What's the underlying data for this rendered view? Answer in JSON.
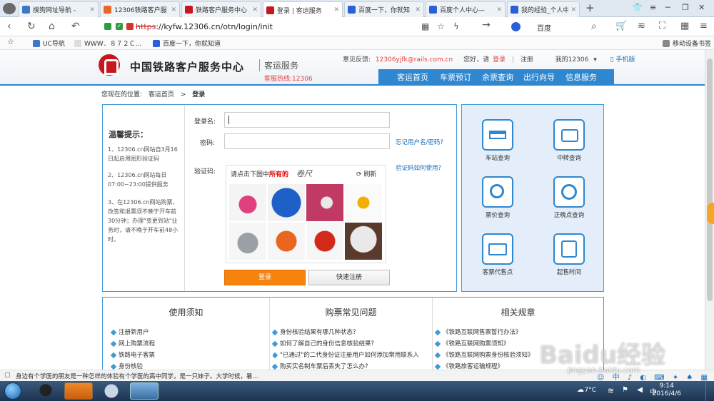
{
  "browser": {
    "tabs": [
      {
        "label": "搜狗网址导航 - ",
        "color": "#3c78c8"
      },
      {
        "label": "12306铁路客户服",
        "color": "#e8652b"
      },
      {
        "label": "铁路客户服务中心",
        "color": "#c8161d"
      },
      {
        "label": "登录 | 客运服务",
        "color": "#c8161d"
      },
      {
        "label": "百度一下，你就知",
        "color": "#2a5fd8"
      },
      {
        "label": "百度个人中心—",
        "color": "#2a5fd8"
      },
      {
        "label": "我的经验_个人中",
        "color": "#2a5fd8"
      }
    ],
    "new_tab": "+",
    "url_scheme": "https",
    "url_rest": "://kyfw.12306.cn/otn/login/init",
    "search_engine": "百度",
    "bookmarks": [
      "UC导航",
      "WWW．８７２Ｃ...",
      "百度一下，你就知道"
    ],
    "mobile_bookmarks": "移动设备书签"
  },
  "header": {
    "site_name": "中国铁路客户服务中心",
    "site_sub": "客运服务",
    "hotline": "客服热线:12306",
    "feedback_label": "意见反馈:",
    "feedback_email": "12306yjfk@rails.com.cn",
    "greeting": "您好，请",
    "login_link": "登录",
    "register_link": "注册",
    "my12306": "我的12306",
    "mobile": "手机版",
    "nav": [
      "客运首页",
      "车票预订",
      "余票查询",
      "出行向导",
      "信息服务"
    ]
  },
  "breadcrumb": {
    "prefix": "您现在的位置:",
    "home": "客运首页",
    "sep": ">",
    "current": "登录"
  },
  "tips": {
    "title": "温馨提示：",
    "items": [
      "1、12306.cn网站自3月16日起启用图形验证码",
      "2、12306.cn网站每日07:00~23:00提供服务",
      "3、在12306.cn网站购票、改签和退票须不晚于开车前30分钟；办理\"变更到站\"业务时，请不晚于开车前48小时。"
    ]
  },
  "login": {
    "username_label": "登录名:",
    "password_label": "密码:",
    "forgot_link": "忘记用户名/密码?",
    "captcha_label": "验证码:",
    "captcha_help": "验证码如何使用?",
    "captcha_prompt_a": "请点击下图中",
    "captcha_prompt_b": "所有的",
    "captcha_word": "卷尺",
    "refresh": "刷新",
    "login_button": "登录",
    "register_button": "快速注册"
  },
  "services": [
    {
      "label": "车站查询"
    },
    {
      "label": "中转查询"
    },
    {
      "label": "票价查询"
    },
    {
      "label": "正晚点查询"
    },
    {
      "label": "客票代售点"
    },
    {
      "label": "起售时间"
    }
  ],
  "info": {
    "columns": [
      {
        "title": "使用须知",
        "items": [
          "注册新用户",
          "网上购票流程",
          "铁路电子客票",
          "身份核验"
        ]
      },
      {
        "title": "购票常见问题",
        "items": [
          "身份核验结果有哪几种状态?",
          "如何了解自己的身份信息核验结果?",
          "\"已通过\"的二代身份证注册用户如何添加常用联系人",
          "购买实名制车票后丢失了怎么办?"
        ]
      },
      {
        "title": "相关规章",
        "items": [
          "《铁路互联网售票暂行办法》",
          "《铁路互联网购票须知》",
          "《铁路互联网购票身份核验须知》",
          "《铁路旅客运输规程》"
        ]
      }
    ]
  },
  "statusbar": {
    "news": "身边有个学医的朋友是一种怎样的体验有个学医的高中同学，是一只妹子。大学时候，暑..."
  },
  "taskbar": {
    "temperature": "7°C",
    "time": "9:14",
    "date": "2016/4/6"
  },
  "watermark": {
    "brand": "Baidu经验",
    "site": "jingyan.baidu.com"
  }
}
